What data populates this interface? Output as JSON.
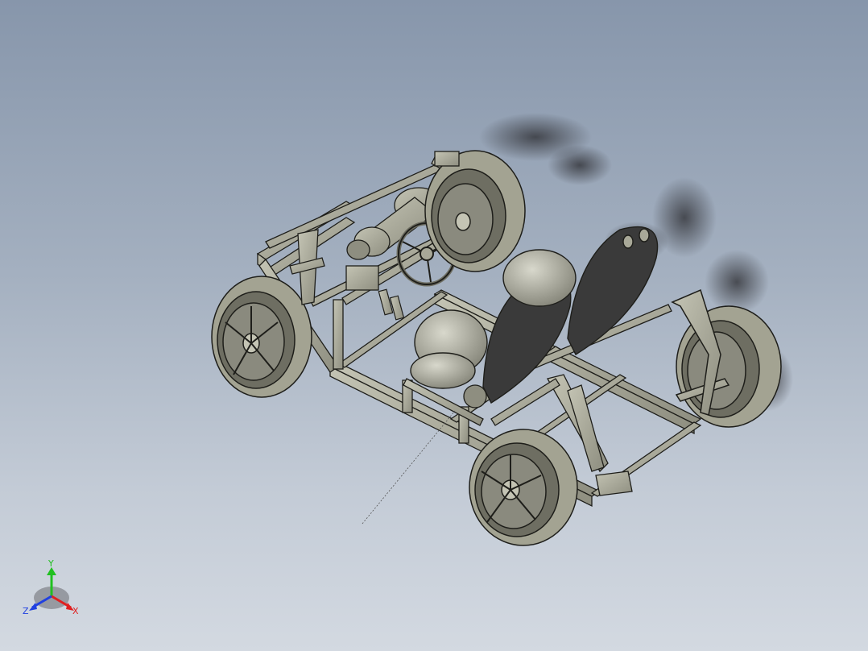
{
  "viewport": {
    "model_description_icon": "go-kart-chassis-assembly",
    "background_top": "#8796ab",
    "background_bottom": "#d3d9e1"
  },
  "model_colors": {
    "metal": "#a8a898",
    "metal_dark": "#6e6e62",
    "tire": "#a3a392",
    "seat_back": "#3a3a3a",
    "edge": "#1e1e1a",
    "shadow": "#2a2a2e"
  },
  "triad": {
    "x_label": "X",
    "y_label": "Y",
    "z_label": "Z",
    "x_color": "#e02020",
    "y_color": "#20c020",
    "z_color": "#2040e0"
  }
}
